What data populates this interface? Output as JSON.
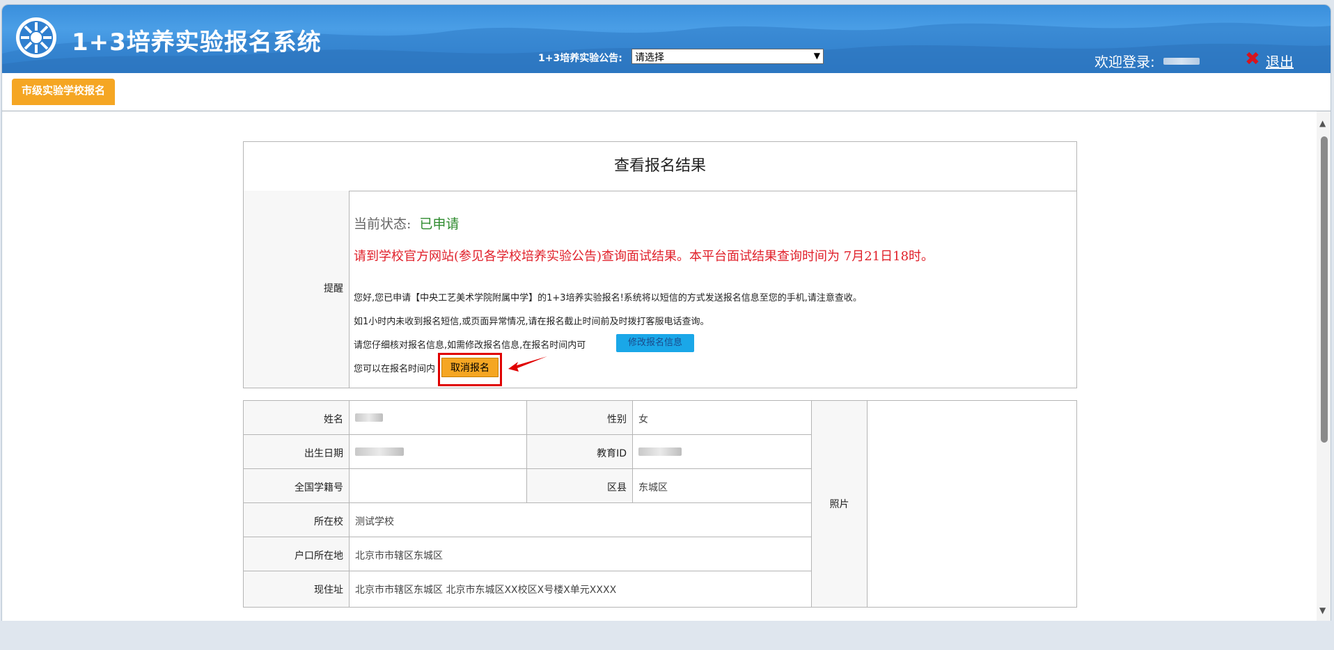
{
  "header": {
    "title": "1+3培养实验报名系统",
    "notice_label": "1+3培养实验公告:",
    "notice_select_value": "请选择",
    "welcome": "欢迎登录:",
    "logout": "退出",
    "colors": {
      "brand_blue": "#3a8fdc",
      "logout_red": "#d6141e"
    }
  },
  "tabs": [
    {
      "label": "市级实验学校报名"
    }
  ],
  "result": {
    "title": "查看报名结果",
    "row_label": "提醒",
    "status_label": "当前状态:",
    "status_value": "已申请",
    "red_notice": "请到学校官方网站(参见各学校培养实验公告)查询面试结果。本平台面试结果查询时间为 7月21日18时。",
    "line1": "您好,您已申请【中央工艺美术学院附属中学】的1+3培养实验报名!系统将以短信的方式发送报名信息至您的手机,请注意查收。",
    "line2": "如1小时内未收到报名短信,或页面异常情况,请在报名截止时间前及时拨打客服电话查询。",
    "line3": "请您仔细核对报名信息,如需修改报名信息,在报名时间内可",
    "modify_button": "修改报名信息",
    "line4": "您可以在报名时间内",
    "cancel_button": "取消报名"
  },
  "student": {
    "name_label": "姓名",
    "gender_label": "性别",
    "gender_value": "女",
    "birth_label": "出生日期",
    "edu_id_label": "教育ID",
    "student_no_label": "全国学籍号",
    "district_label": "区县",
    "district_value": "东城区",
    "school_label": "所在校",
    "school_value": "测试学校",
    "hukou_label": "户口所在地",
    "hukou_value": "北京市市辖区东城区",
    "address_label": "现住址",
    "address_value": "北京市市辖区东城区 北京市东城区XX校区X号楼X单元XXXX",
    "photo_label": "照片"
  }
}
